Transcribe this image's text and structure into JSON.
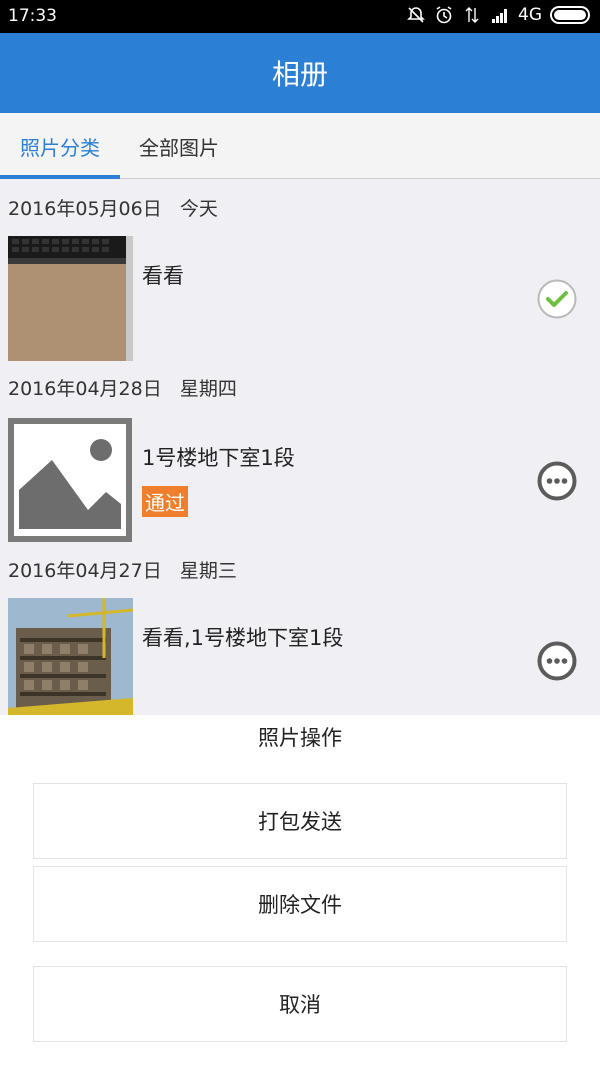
{
  "status_bar": {
    "time": "17:33",
    "network": "4G"
  },
  "app_bar": {
    "title": "相册"
  },
  "tabs": [
    {
      "label": "照片分类",
      "active": true
    },
    {
      "label": "全部图片",
      "active": false
    }
  ],
  "groups": [
    {
      "date": "2016年05月06日",
      "weekday": "今天",
      "item": {
        "title": "看看",
        "badge": "",
        "action": "checked"
      }
    },
    {
      "date": "2016年04月28日",
      "weekday": "星期四",
      "item": {
        "title": "1号楼地下室1段",
        "badge": "通过",
        "action": "more"
      }
    },
    {
      "date": "2016年04月27日",
      "weekday": "星期三",
      "item": {
        "title": "看看,1号楼地下室1段",
        "badge": "",
        "action": "more"
      }
    }
  ],
  "sheet": {
    "title": "照片操作",
    "buttons": [
      "打包发送",
      "删除文件",
      "取消"
    ]
  },
  "colors": {
    "accent": "#2b7fd4",
    "badge": "#ef7f2d",
    "check": "#6cbf3f"
  }
}
